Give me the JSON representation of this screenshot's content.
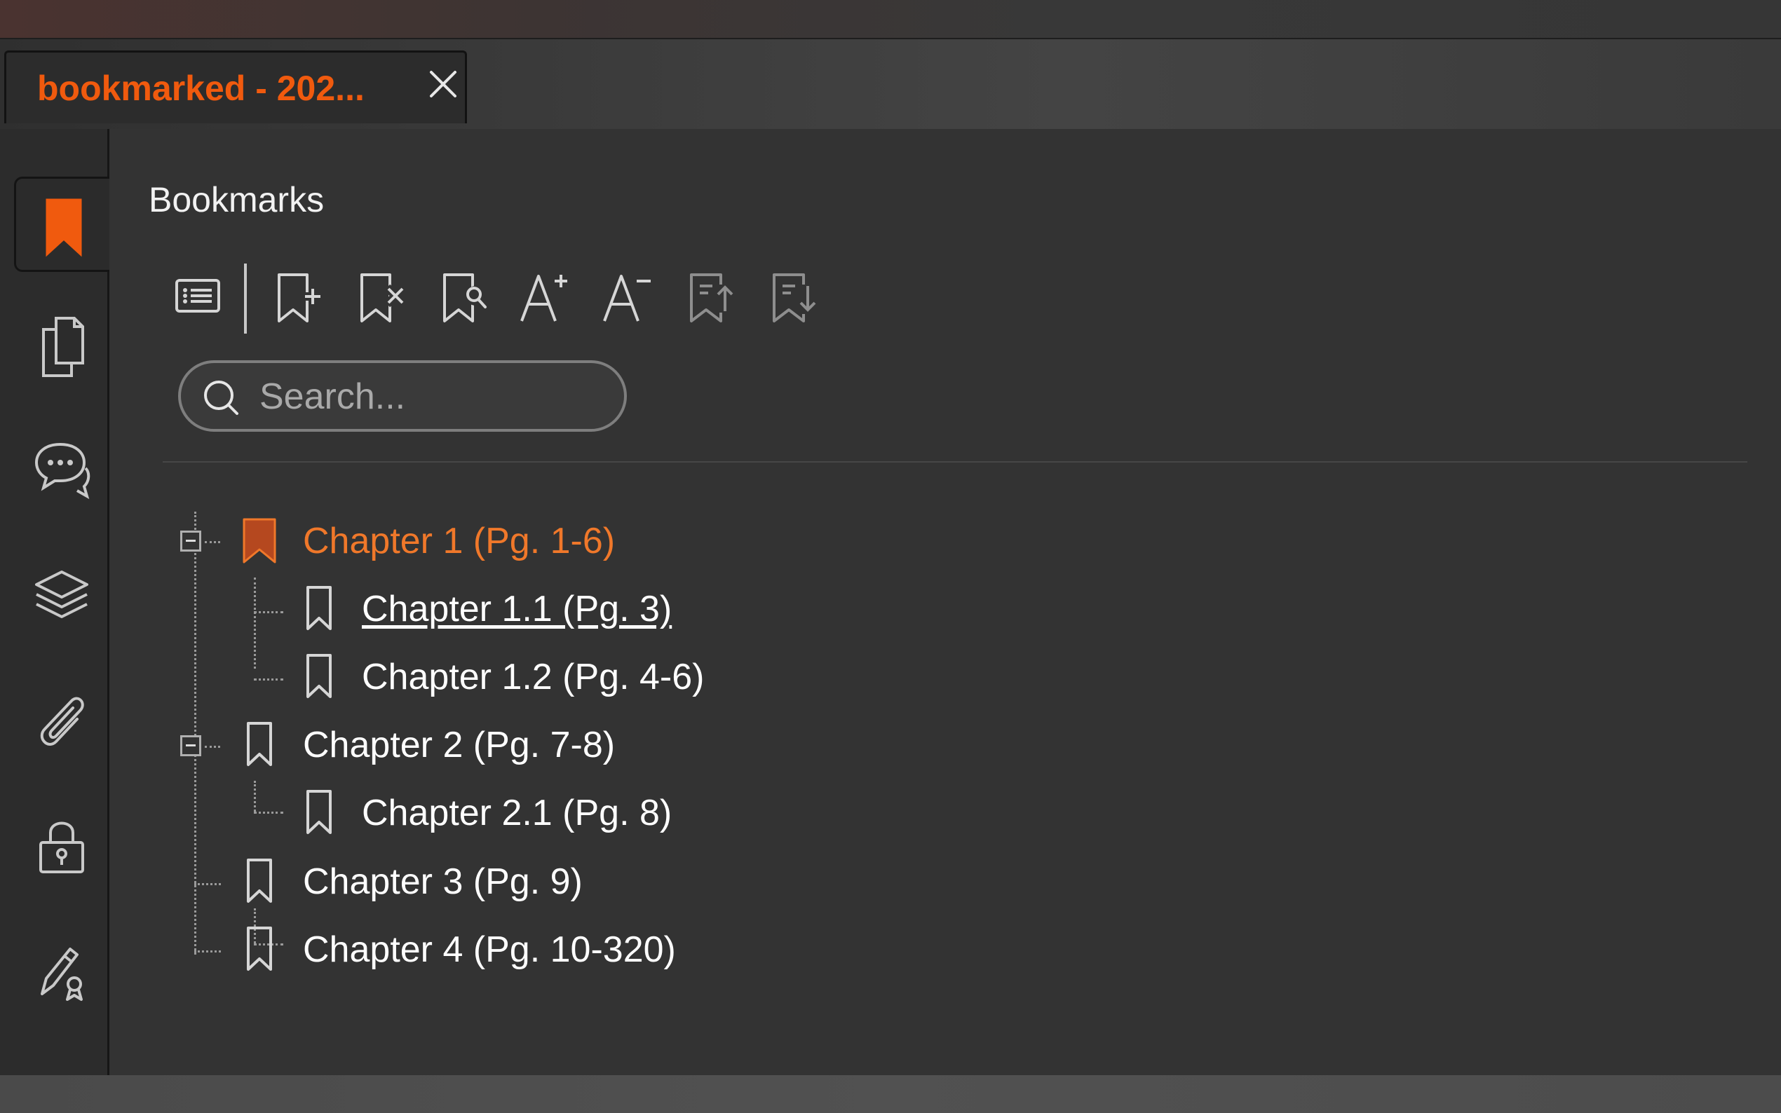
{
  "tab": {
    "title": "bookmarked - 202..."
  },
  "panel": {
    "title": "Bookmarks",
    "search_placeholder": "Search..."
  },
  "sidebar": {
    "items": [
      {
        "icon": "bookmark-icon",
        "active": true
      },
      {
        "icon": "pages-icon"
      },
      {
        "icon": "comments-icon"
      },
      {
        "icon": "layers-icon"
      },
      {
        "icon": "attachment-icon"
      },
      {
        "icon": "lock-icon"
      },
      {
        "icon": "signature-icon"
      }
    ]
  },
  "toolbar": [
    {
      "icon": "list-options-icon"
    },
    {
      "icon": "add-bookmark-icon"
    },
    {
      "icon": "delete-bookmark-icon"
    },
    {
      "icon": "find-bookmark-icon"
    },
    {
      "icon": "increase-text-size-icon"
    },
    {
      "icon": "decrease-text-size-icon"
    },
    {
      "icon": "move-bookmark-up-icon"
    },
    {
      "icon": "move-bookmark-down-icon"
    }
  ],
  "bookmarks": [
    {
      "label": "Chapter 1 (Pg. 1-6)",
      "level": 0,
      "expanded": true,
      "selected": true
    },
    {
      "label": "Chapter 1.1 (Pg. 3)",
      "level": 1,
      "hovered": true
    },
    {
      "label": "Chapter 1.2 (Pg. 4-6)",
      "level": 1
    },
    {
      "label": "Chapter 2 (Pg. 7-8)",
      "level": 0,
      "expanded": true
    },
    {
      "label": "Chapter 2.1 (Pg. 8)",
      "level": 1
    },
    {
      "label": "Chapter 3 (Pg. 9)",
      "level": 0
    },
    {
      "label": "Chapter 4 (Pg. 10-320)",
      "level": 0
    }
  ],
  "colors": {
    "accent": "#f05a0e",
    "selected_label": "#f0782a",
    "panel_bg": "#333333",
    "selected_bookmark_fill": "#b5481f"
  }
}
